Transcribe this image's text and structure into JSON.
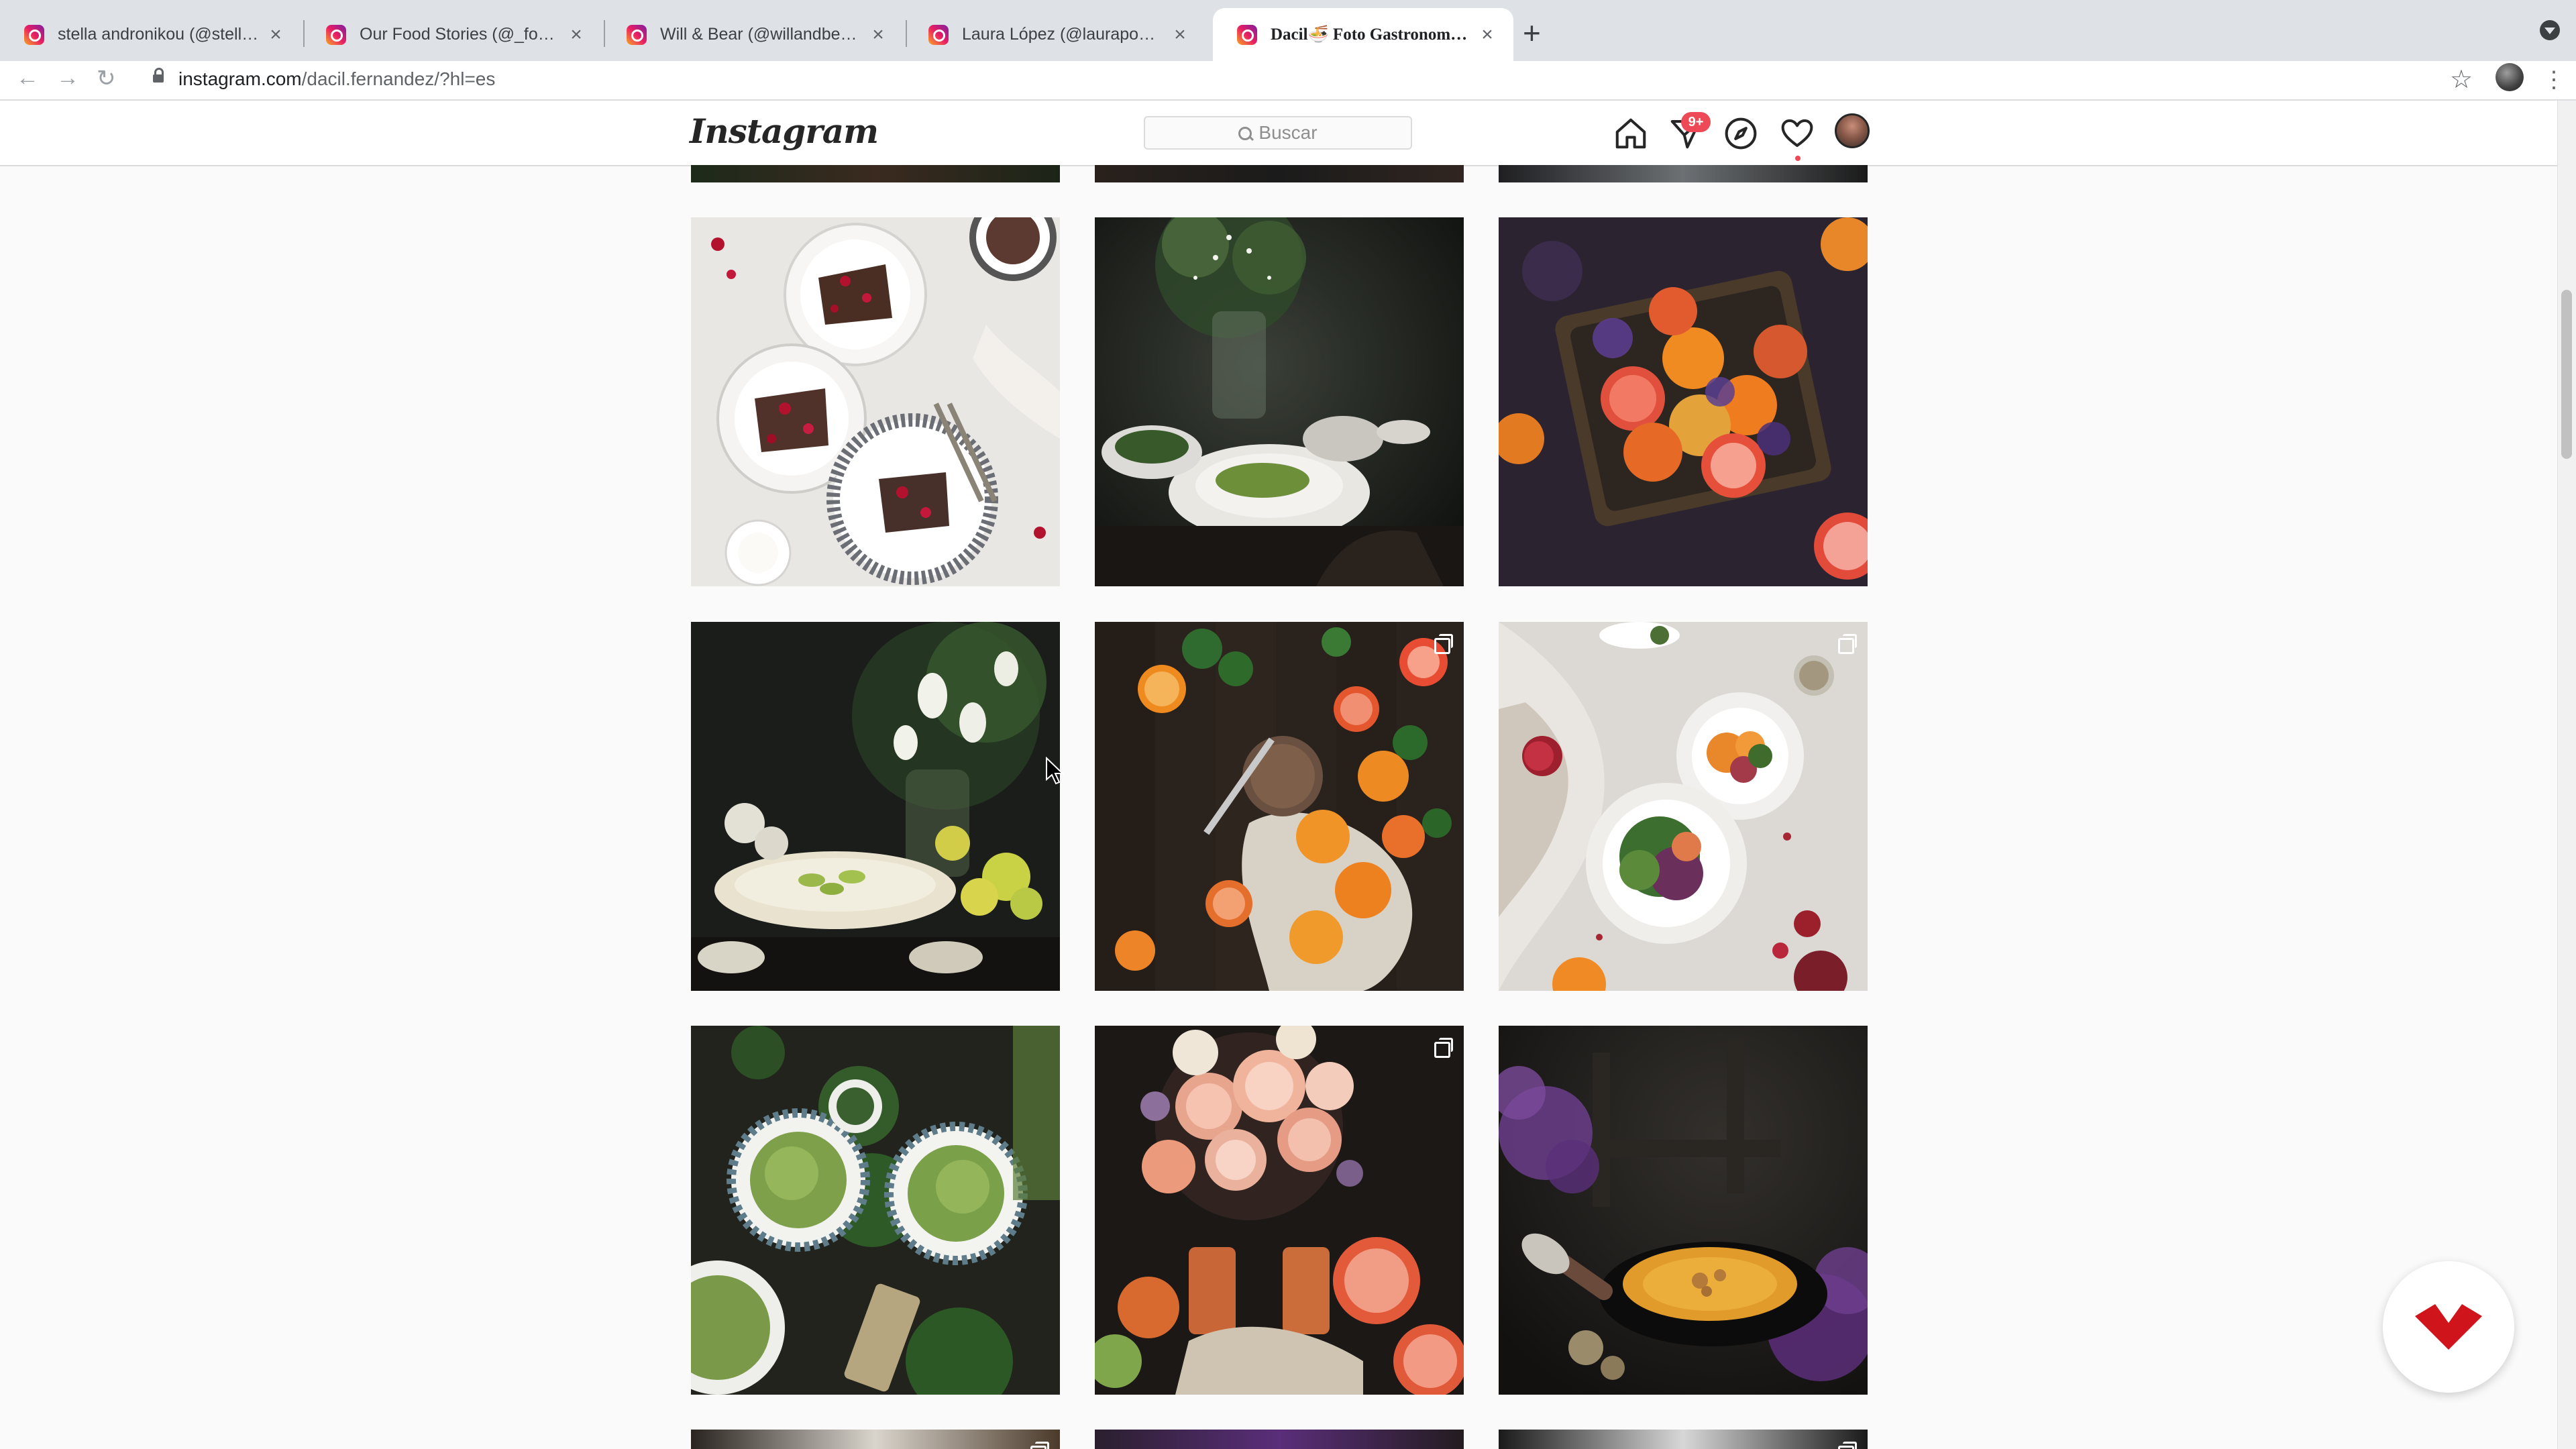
{
  "browser": {
    "tabs": [
      {
        "title": "stella andronikou (@stellaandronikou)"
      },
      {
        "title": "Our Food Stories (@_foodstories_)"
      },
      {
        "title": "Will & Bear (@willandbear) • Fotos"
      },
      {
        "title": "Laura López (@laurapontsi) • Fotos"
      },
      {
        "title": "Dacil🍜 Foto Gastronomica (@dacil.fernandez)"
      }
    ],
    "new_tab_glyph": "+",
    "close_glyph": "×",
    "url_host": "instagram.com",
    "url_path": "/dacil.fernandez/?hl=es"
  },
  "instagram": {
    "logo_text": "Instagram",
    "search_placeholder": "Buscar",
    "notification_count": "9+",
    "nav_icons": [
      "home-icon",
      "direct-messages-icon",
      "explore-compass-icon",
      "activity-heart-icon",
      "profile-avatar"
    ]
  },
  "grid": {
    "posts": [
      {
        "subject": "chocolate crepes with berries",
        "multi": false
      },
      {
        "subject": "green pasta with flowers",
        "multi": false
      },
      {
        "subject": "citrus fruits in basket",
        "multi": false
      },
      {
        "subject": "lime tart with tulips",
        "multi": false
      },
      {
        "subject": "oranges and knife",
        "multi": true
      },
      {
        "subject": "salad with pomegranate",
        "multi": true
      },
      {
        "subject": "asparagus pesto pasta",
        "multi": false
      },
      {
        "subject": "peach roses and grapefruit",
        "multi": true
      },
      {
        "subject": "pumpkin soup",
        "multi": false
      }
    ]
  },
  "colors": {
    "instagram_badge": "#ed4956",
    "floating_button_mark": "#d0141b"
  }
}
